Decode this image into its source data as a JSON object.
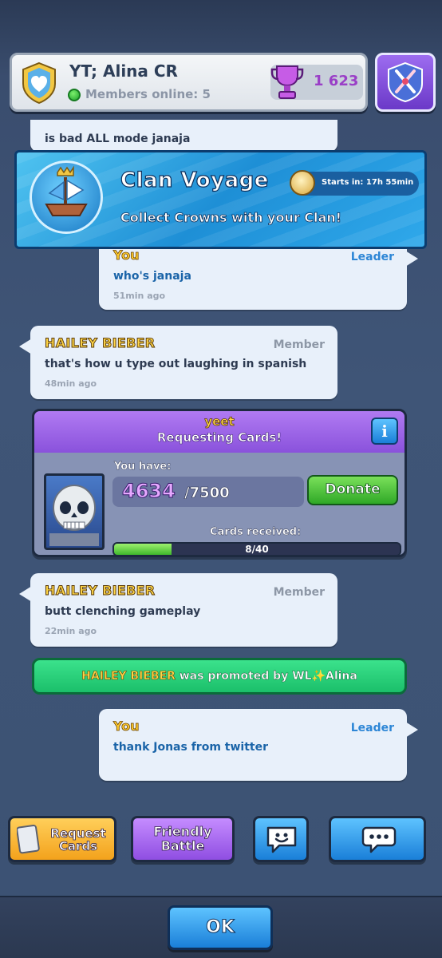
{
  "header": {
    "clan_name": "YT; Alina CR",
    "members_online": "Members online: 5",
    "trophies": "1 623"
  },
  "messages": {
    "partial_top": "is bad ALL mode janaja",
    "you_1": {
      "name": "You",
      "role": "Leader",
      "text": "who's janaja",
      "time": "51min ago"
    },
    "hailey_1": {
      "name": "HAILEY BIEBER",
      "role": "Member",
      "text": "that's how u type out laughing in spanish",
      "time": "48min ago"
    },
    "hailey_2": {
      "name": "HAILEY BIEBER",
      "role": "Member",
      "text": "butt clenching gameplay",
      "time": "22min ago"
    },
    "you_2": {
      "name": "You",
      "role": "Leader",
      "text": "thank Jonas from twitter"
    }
  },
  "voyage": {
    "title": "Clan Voyage",
    "timer": "Starts in: 17h 55min",
    "subtitle": "Collect Crowns with your Clan!"
  },
  "request": {
    "user": "yeet",
    "title": "Requesting Cards!",
    "info_label": "i",
    "you_have_label": "You have:",
    "have_count": "4634",
    "have_max": "/7500",
    "donate_label": "Donate",
    "received_label": "Cards received:",
    "received_text": "8/40",
    "received_fraction": 0.2
  },
  "promotion": {
    "name": "HAILEY BIEBER",
    "text": "was promoted by WL✨Alina"
  },
  "actions": {
    "request_line1": "Request",
    "request_line2": "Cards",
    "friendly_line1": "Friendly",
    "friendly_line2": "Battle",
    "ok": "OK"
  },
  "icons": {
    "clan_badge": "shield-heart-icon",
    "trophy": "trophy-icon",
    "battle": "crossed-swords-icon",
    "clock": "clock-icon",
    "emote": "emote-bubble-icon",
    "chat": "chat-bubble-icon"
  },
  "colors": {
    "yellow_name": "#ffd646",
    "leader_blue": "#2d86d6",
    "purple_request": "#8a52dc",
    "green_promo": "#1bbf6a"
  }
}
